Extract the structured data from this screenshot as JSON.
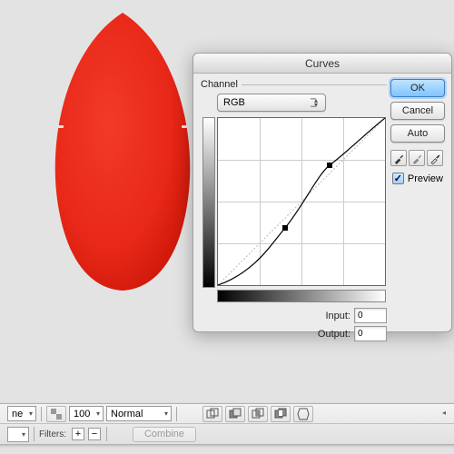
{
  "dialog": {
    "title": "Curves",
    "channel_label": "Channel",
    "channel_value": "RGB",
    "input_label": "Input:",
    "input_value": "0",
    "output_label": "Output:",
    "output_value": "0",
    "ok": "OK",
    "cancel": "Cancel",
    "auto": "Auto",
    "preview_label": "Preview",
    "preview_checked": "✓"
  },
  "toolbar": {
    "stroke_none": "ne",
    "opacity": "100",
    "blend_mode": "Normal",
    "filters_label": "Filters:",
    "combine": "Combine",
    "plus": "+",
    "minus": "−"
  },
  "chart_data": {
    "type": "line",
    "title": "Curves",
    "xlabel": "Input",
    "ylabel": "Output",
    "xlim": [
      0,
      255
    ],
    "ylim": [
      0,
      255
    ],
    "points": [
      {
        "x": 0,
        "y": 0
      },
      {
        "x": 103,
        "y": 88
      },
      {
        "x": 170,
        "y": 183
      },
      {
        "x": 255,
        "y": 255
      }
    ]
  }
}
